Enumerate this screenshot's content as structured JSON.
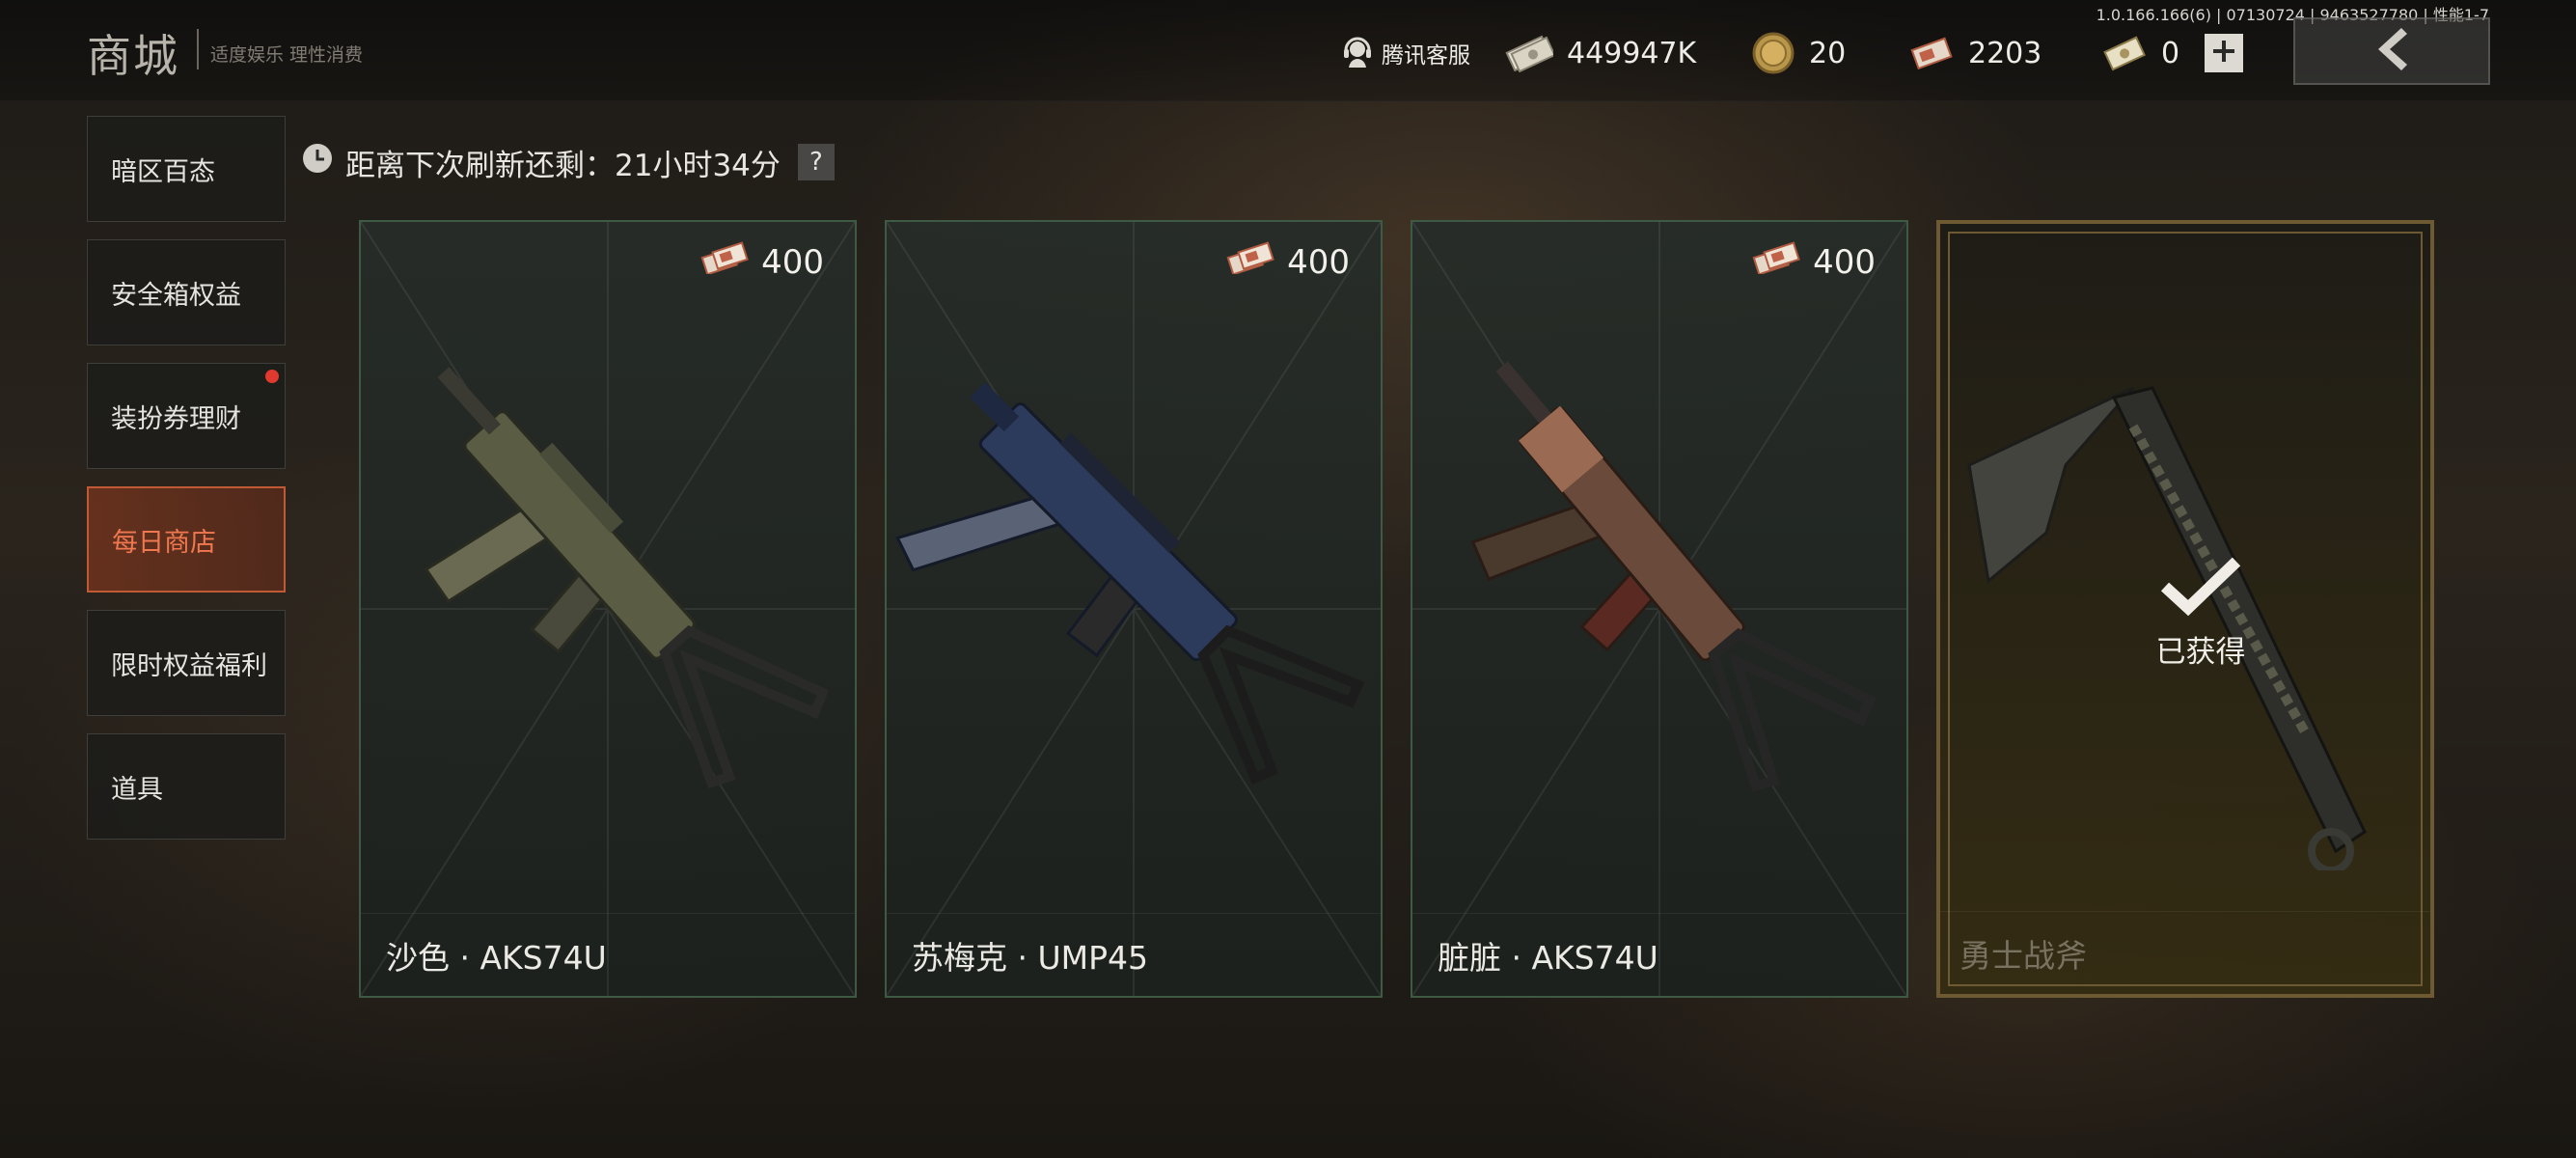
{
  "header": {
    "title": "商城",
    "subtitle": "适度娱乐 理性消费",
    "version": "1.0.166.166(6) | 07130724 | 9463527780 | 性能1-7",
    "customer_service": "腾讯客服",
    "currencies": [
      {
        "icon": "banknote-icon",
        "value": "449947K"
      },
      {
        "icon": "gold-coin-icon",
        "value": "20"
      },
      {
        "icon": "ticket-icon",
        "value": "2203"
      },
      {
        "icon": "voucher-icon",
        "value": "0"
      }
    ],
    "plus_label": "+",
    "back_label": "<"
  },
  "sidebar": {
    "items": [
      {
        "label": "暗区百态",
        "active": false,
        "badge": false
      },
      {
        "label": "安全箱权益",
        "active": false,
        "badge": false
      },
      {
        "label": "装扮券理财",
        "active": false,
        "badge": true
      },
      {
        "label": "每日商店",
        "active": true,
        "badge": false
      },
      {
        "label": "限时权益福利",
        "active": false,
        "badge": false
      },
      {
        "label": "道具",
        "active": false,
        "badge": false
      }
    ]
  },
  "refresh": {
    "label": "距离下次刷新还剩：21小时34分",
    "help": "?"
  },
  "cards": [
    {
      "name": "沙色 · AKS74U",
      "price": "400",
      "owned": false,
      "color": "#5a5c44"
    },
    {
      "name": "苏梅克 · UMP45",
      "price": "400",
      "owned": false,
      "color": "#2c3a5c"
    },
    {
      "name": "脏脏 · AKS74U",
      "price": "400",
      "owned": false,
      "color": "#6a4a3a"
    },
    {
      "name": "勇士战斧",
      "price": "",
      "owned": true,
      "owned_label": "已获得"
    }
  ],
  "colors": {
    "accent_active": "#f07850",
    "card_border": "#3e5a44",
    "owned_border": "#6e5a32",
    "badge": "#e03a2e"
  }
}
